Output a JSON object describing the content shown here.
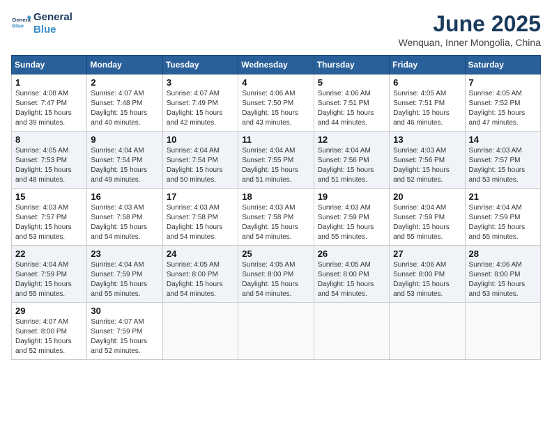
{
  "logo": {
    "line1": "General",
    "line2": "Blue"
  },
  "title": "June 2025",
  "subtitle": "Wenquan, Inner Mongolia, China",
  "weekdays": [
    "Sunday",
    "Monday",
    "Tuesday",
    "Wednesday",
    "Thursday",
    "Friday",
    "Saturday"
  ],
  "weeks": [
    [
      {
        "day": "1",
        "sunrise": "Sunrise: 4:08 AM",
        "sunset": "Sunset: 7:47 PM",
        "daylight": "Daylight: 15 hours and 39 minutes."
      },
      {
        "day": "2",
        "sunrise": "Sunrise: 4:07 AM",
        "sunset": "Sunset: 7:48 PM",
        "daylight": "Daylight: 15 hours and 40 minutes."
      },
      {
        "day": "3",
        "sunrise": "Sunrise: 4:07 AM",
        "sunset": "Sunset: 7:49 PM",
        "daylight": "Daylight: 15 hours and 42 minutes."
      },
      {
        "day": "4",
        "sunrise": "Sunrise: 4:06 AM",
        "sunset": "Sunset: 7:50 PM",
        "daylight": "Daylight: 15 hours and 43 minutes."
      },
      {
        "day": "5",
        "sunrise": "Sunrise: 4:06 AM",
        "sunset": "Sunset: 7:51 PM",
        "daylight": "Daylight: 15 hours and 44 minutes."
      },
      {
        "day": "6",
        "sunrise": "Sunrise: 4:05 AM",
        "sunset": "Sunset: 7:51 PM",
        "daylight": "Daylight: 15 hours and 46 minutes."
      },
      {
        "day": "7",
        "sunrise": "Sunrise: 4:05 AM",
        "sunset": "Sunset: 7:52 PM",
        "daylight": "Daylight: 15 hours and 47 minutes."
      }
    ],
    [
      {
        "day": "8",
        "sunrise": "Sunrise: 4:05 AM",
        "sunset": "Sunset: 7:53 PM",
        "daylight": "Daylight: 15 hours and 48 minutes."
      },
      {
        "day": "9",
        "sunrise": "Sunrise: 4:04 AM",
        "sunset": "Sunset: 7:54 PM",
        "daylight": "Daylight: 15 hours and 49 minutes."
      },
      {
        "day": "10",
        "sunrise": "Sunrise: 4:04 AM",
        "sunset": "Sunset: 7:54 PM",
        "daylight": "Daylight: 15 hours and 50 minutes."
      },
      {
        "day": "11",
        "sunrise": "Sunrise: 4:04 AM",
        "sunset": "Sunset: 7:55 PM",
        "daylight": "Daylight: 15 hours and 51 minutes."
      },
      {
        "day": "12",
        "sunrise": "Sunrise: 4:04 AM",
        "sunset": "Sunset: 7:56 PM",
        "daylight": "Daylight: 15 hours and 51 minutes."
      },
      {
        "day": "13",
        "sunrise": "Sunrise: 4:03 AM",
        "sunset": "Sunset: 7:56 PM",
        "daylight": "Daylight: 15 hours and 52 minutes."
      },
      {
        "day": "14",
        "sunrise": "Sunrise: 4:03 AM",
        "sunset": "Sunset: 7:57 PM",
        "daylight": "Daylight: 15 hours and 53 minutes."
      }
    ],
    [
      {
        "day": "15",
        "sunrise": "Sunrise: 4:03 AM",
        "sunset": "Sunset: 7:57 PM",
        "daylight": "Daylight: 15 hours and 53 minutes."
      },
      {
        "day": "16",
        "sunrise": "Sunrise: 4:03 AM",
        "sunset": "Sunset: 7:58 PM",
        "daylight": "Daylight: 15 hours and 54 minutes."
      },
      {
        "day": "17",
        "sunrise": "Sunrise: 4:03 AM",
        "sunset": "Sunset: 7:58 PM",
        "daylight": "Daylight: 15 hours and 54 minutes."
      },
      {
        "day": "18",
        "sunrise": "Sunrise: 4:03 AM",
        "sunset": "Sunset: 7:58 PM",
        "daylight": "Daylight: 15 hours and 54 minutes."
      },
      {
        "day": "19",
        "sunrise": "Sunrise: 4:03 AM",
        "sunset": "Sunset: 7:59 PM",
        "daylight": "Daylight: 15 hours and 55 minutes."
      },
      {
        "day": "20",
        "sunrise": "Sunrise: 4:04 AM",
        "sunset": "Sunset: 7:59 PM",
        "daylight": "Daylight: 15 hours and 55 minutes."
      },
      {
        "day": "21",
        "sunrise": "Sunrise: 4:04 AM",
        "sunset": "Sunset: 7:59 PM",
        "daylight": "Daylight: 15 hours and 55 minutes."
      }
    ],
    [
      {
        "day": "22",
        "sunrise": "Sunrise: 4:04 AM",
        "sunset": "Sunset: 7:59 PM",
        "daylight": "Daylight: 15 hours and 55 minutes."
      },
      {
        "day": "23",
        "sunrise": "Sunrise: 4:04 AM",
        "sunset": "Sunset: 7:59 PM",
        "daylight": "Daylight: 15 hours and 55 minutes."
      },
      {
        "day": "24",
        "sunrise": "Sunrise: 4:05 AM",
        "sunset": "Sunset: 8:00 PM",
        "daylight": "Daylight: 15 hours and 54 minutes."
      },
      {
        "day": "25",
        "sunrise": "Sunrise: 4:05 AM",
        "sunset": "Sunset: 8:00 PM",
        "daylight": "Daylight: 15 hours and 54 minutes."
      },
      {
        "day": "26",
        "sunrise": "Sunrise: 4:05 AM",
        "sunset": "Sunset: 8:00 PM",
        "daylight": "Daylight: 15 hours and 54 minutes."
      },
      {
        "day": "27",
        "sunrise": "Sunrise: 4:06 AM",
        "sunset": "Sunset: 8:00 PM",
        "daylight": "Daylight: 15 hours and 53 minutes."
      },
      {
        "day": "28",
        "sunrise": "Sunrise: 4:06 AM",
        "sunset": "Sunset: 8:00 PM",
        "daylight": "Daylight: 15 hours and 53 minutes."
      }
    ],
    [
      {
        "day": "29",
        "sunrise": "Sunrise: 4:07 AM",
        "sunset": "Sunset: 8:00 PM",
        "daylight": "Daylight: 15 hours and 52 minutes."
      },
      {
        "day": "30",
        "sunrise": "Sunrise: 4:07 AM",
        "sunset": "Sunset: 7:59 PM",
        "daylight": "Daylight: 15 hours and 52 minutes."
      },
      null,
      null,
      null,
      null,
      null
    ]
  ]
}
